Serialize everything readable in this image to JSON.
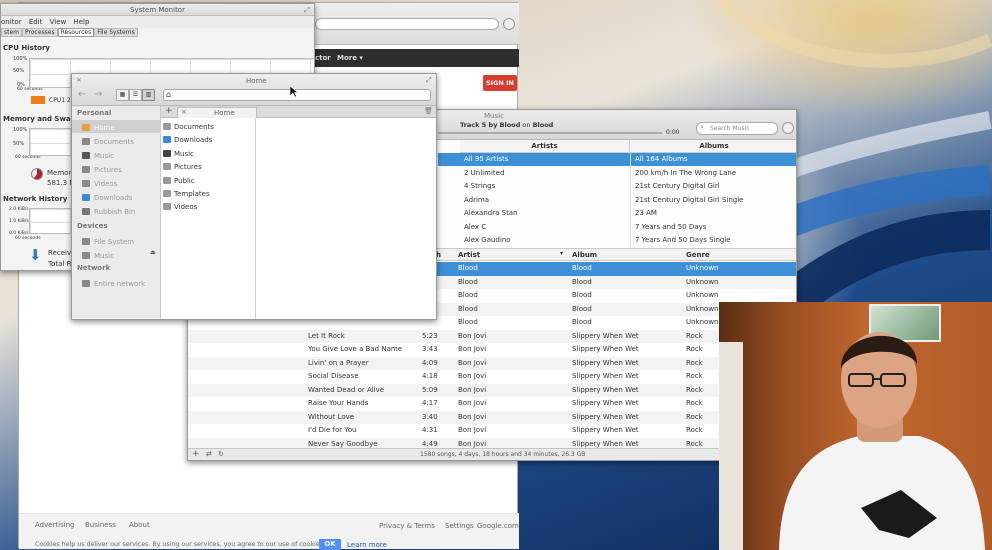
{
  "desktop": {
    "wallpaper_colors": [
      "#c9b9a2",
      "#1c3a6e",
      "#e4c98f"
    ]
  },
  "browser": {
    "signin_label": "SIGN IN",
    "menu_bar_items": [
      "ctor",
      "More ▾"
    ],
    "footer": {
      "left_links": [
        "Advertising",
        "Business",
        "About"
      ],
      "right_links": [
        "Privacy & Terms",
        "Settings",
        "Google.com"
      ],
      "cookie_text": "Cookies help us deliver our services. By using our services, you agree to our use of cookies.",
      "ok_label": "OK",
      "learn_more_label": "Learn more"
    }
  },
  "system_monitor": {
    "title": "System Monitor",
    "menu": [
      "onitor",
      "Edit",
      "View",
      "Help"
    ],
    "tabs": [
      "stem",
      "Processes",
      "Resources",
      "File Systems"
    ],
    "active_tab": 2,
    "cpu_heading": "CPU History",
    "cpu_ticks": [
      "100%",
      "50%",
      "0%",
      "60 seconds"
    ],
    "cpu_legend": "CPU1  2",
    "mem_heading": "Memory and Swap History",
    "mem_ticks": [
      "100%",
      "50%",
      "60 seconds"
    ],
    "mem_label": "Memory",
    "mem_value": "581.3 M",
    "net_heading": "Network History",
    "net_ticks": [
      "2.0 KiB/s",
      "1.0 KiB/s",
      "0.0 KiB/s",
      "60 seconds"
    ],
    "net_receive_label": "Receivi",
    "net_total_label": "Total Re"
  },
  "files": {
    "title": "Home",
    "sidebar": {
      "personal_heading": "Personal",
      "personal_items": [
        {
          "label": "Home",
          "icon": "home-icon",
          "color": "#e9a03b"
        },
        {
          "label": "Documents",
          "icon": "documents-icon",
          "color": "#8a8a8a"
        },
        {
          "label": "Music",
          "icon": "music-icon",
          "color": "#555555"
        },
        {
          "label": "Pictures",
          "icon": "pictures-icon",
          "color": "#8a8a8a"
        },
        {
          "label": "Videos",
          "icon": "videos-icon",
          "color": "#8a8a8a"
        },
        {
          "label": "Downloads",
          "icon": "downloads-icon",
          "color": "#3a8ad8"
        },
        {
          "label": "Rubbish Bin",
          "icon": "trash-icon",
          "color": "#777777"
        }
      ],
      "devices_heading": "Devices",
      "device_items": [
        {
          "label": "File System",
          "icon": "drive-icon"
        },
        {
          "label": "Music",
          "icon": "drive-icon"
        }
      ],
      "network_heading": "Network",
      "network_items": [
        {
          "label": "Entire network",
          "icon": "network-icon"
        }
      ]
    },
    "tab_label": "Home",
    "entries": [
      {
        "label": "Documents",
        "icon": "folder-icon"
      },
      {
        "label": "Downloads",
        "icon": "downloads-folder-icon"
      },
      {
        "label": "Music",
        "icon": "music-folder-icon"
      },
      {
        "label": "Pictures",
        "icon": "folder-icon"
      },
      {
        "label": "Public",
        "icon": "folder-icon"
      },
      {
        "label": "Templates",
        "icon": "folder-icon"
      },
      {
        "label": "Videos",
        "icon": "folder-icon"
      }
    ]
  },
  "music": {
    "title": "Music",
    "now_playing": {
      "prefix": "Track 5 by",
      "artist": "Blood",
      "mid": "on",
      "album": "Blood"
    },
    "time_elapsed": "0:00",
    "search_placeholder": "Search Music",
    "artist_header": "Artists",
    "album_header": "Albums",
    "artists": [
      "All 95 Artists",
      "2 Unlimited",
      "4 Strings",
      "Adrima",
      "Alexandra Stan",
      "Alex C",
      "Alex Gaudino"
    ],
    "albums": [
      "All 164 Albums",
      "200 km/h In The Wrong Lane",
      "21st Century Digital Girl",
      "21st Century Digital Girl Single",
      "23 AM",
      "7 Years and 50 Days",
      "7 Years And 50 Days Single"
    ],
    "columns": [
      "h",
      "Artist",
      "Album",
      "Genre"
    ],
    "rows": [
      {
        "title": "",
        "length": "",
        "artist": "Blood",
        "album": "Blood",
        "genre": "Unknown"
      },
      {
        "title": "",
        "length": "",
        "artist": "Blood",
        "album": "Blood",
        "genre": "Unknown"
      },
      {
        "title": "",
        "length": "",
        "artist": "Blood",
        "album": "Blood",
        "genre": "Unknown"
      },
      {
        "title": "",
        "length": "",
        "artist": "Blood",
        "album": "Blood",
        "genre": "Unknown"
      },
      {
        "title": "",
        "length": "",
        "artist": "Blood",
        "album": "Blood",
        "genre": "Unknown"
      },
      {
        "title": "Let It Rock",
        "length": "5:23",
        "artist": "Bon Jovi",
        "album": "Slippery When Wet",
        "genre": "Rock"
      },
      {
        "title": "You Give Love a Bad Name",
        "length": "3:43",
        "artist": "Bon Jovi",
        "album": "Slippery When Wet",
        "genre": "Rock"
      },
      {
        "title": "Livin' on a Prayer",
        "length": "4:09",
        "artist": "Bon Jovi",
        "album": "Slippery When Wet",
        "genre": "Rock"
      },
      {
        "title": "Social Disease",
        "length": "4:18",
        "artist": "Bon Jovi",
        "album": "Slippery When Wet",
        "genre": "Rock"
      },
      {
        "title": "Wanted Dead or Alive",
        "length": "5:09",
        "artist": "Bon Jovi",
        "album": "Slippery When Wet",
        "genre": "Rock"
      },
      {
        "title": "Raise Your Hands",
        "length": "4:17",
        "artist": "Bon Jovi",
        "album": "Slippery When Wet",
        "genre": "Rock"
      },
      {
        "title": "Without Love",
        "length": "3:40",
        "artist": "Bon Jovi",
        "album": "Slippery When Wet",
        "genre": "Rock"
      },
      {
        "title": "I'd Die for You",
        "length": "4:31",
        "artist": "Bon Jovi",
        "album": "Slippery When Wet",
        "genre": "Rock"
      },
      {
        "title": "Never Say Goodbye",
        "length": "4:49",
        "artist": "Bon Jovi",
        "album": "Slippery When Wet",
        "genre": "Rock"
      }
    ],
    "status": "1580 songs, 4 days, 18 hours and 34 minutes, 26.3 GB",
    "accent_color": "#3d8fd6"
  },
  "webcam": {
    "wall_color": "#b5622c",
    "shirt_color": "#f4f4f4"
  }
}
